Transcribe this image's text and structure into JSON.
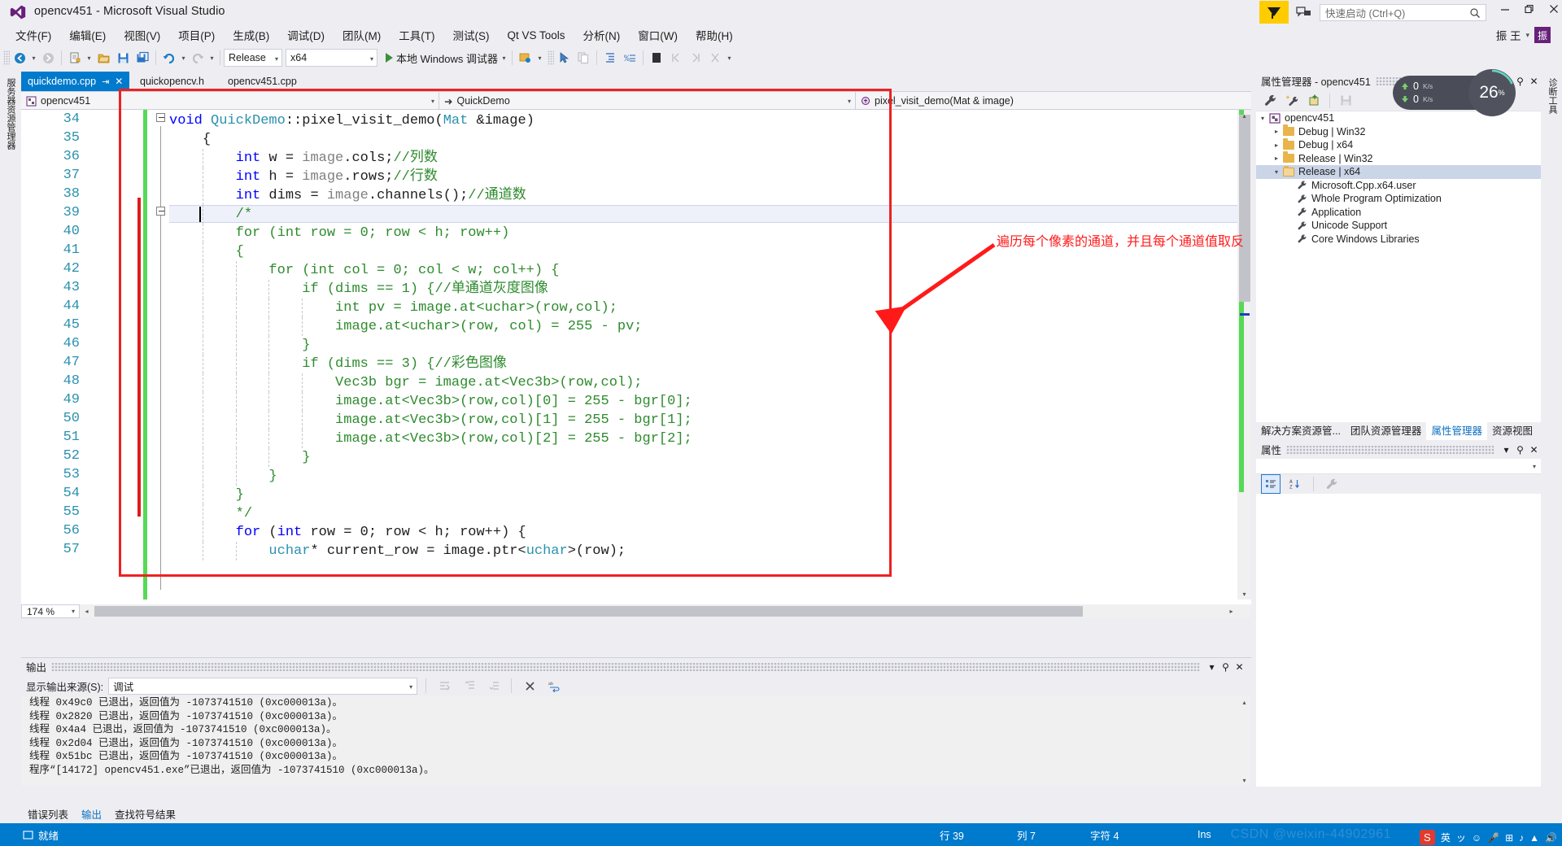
{
  "window": {
    "title": "opencv451 - Microsoft Visual Studio",
    "minimize": "—",
    "restore": "❐",
    "close": "✕",
    "user_name": "振 王",
    "user_caret": "▾",
    "avatar_initial": "振"
  },
  "quick_launch": {
    "placeholder": "快速启动 (Ctrl+Q)",
    "value": ""
  },
  "menu": {
    "items": [
      "文件(F)",
      "编辑(E)",
      "视图(V)",
      "项目(P)",
      "生成(B)",
      "调试(D)",
      "团队(M)",
      "工具(T)",
      "测试(S)",
      "Qt VS Tools",
      "分析(N)",
      "窗口(W)",
      "帮助(H)"
    ]
  },
  "toolbar": {
    "config": "Release",
    "platform": "x64",
    "run_label": "本地 Windows 调试器",
    "caret": "▾"
  },
  "editor_tabs": [
    {
      "label": "quickdemo.cpp",
      "active": true,
      "pin": "⇥",
      "close": "✕"
    },
    {
      "label": "quickopencv.h",
      "active": false
    },
    {
      "label": "opencv451.cpp",
      "active": false
    }
  ],
  "left_strip_label": "服务器资源管理器",
  "right_strip_label": "诊断工具",
  "navbar": {
    "project": "opencv451",
    "class": "QuickDemo",
    "member": "pixel_visit_demo(Mat & image)",
    "caret": "▾",
    "class_arrow": "➜",
    "member_icon": "⬤"
  },
  "code": {
    "first_line_number": 34,
    "lines": [
      {
        "n": 34,
        "indent": 0,
        "tokens": [
          {
            "t": "void ",
            "c": "kw"
          },
          {
            "t": "QuickDemo",
            "c": "typ"
          },
          {
            "t": "::pixel_visit_demo(",
            "c": ""
          },
          {
            "t": "Mat",
            "c": "typ"
          },
          {
            "t": " &image)",
            "c": ""
          }
        ]
      },
      {
        "n": 35,
        "indent": 1,
        "tokens": [
          {
            "t": "{",
            "c": ""
          }
        ]
      },
      {
        "n": 36,
        "indent": 2,
        "tokens": [
          {
            "t": "int",
            "c": "kw"
          },
          {
            "t": " w = ",
            "c": ""
          },
          {
            "t": "image",
            "c": "id-g"
          },
          {
            "t": ".cols;",
            "c": ""
          },
          {
            "t": "//列数",
            "c": "cmt"
          }
        ]
      },
      {
        "n": 37,
        "indent": 2,
        "tokens": [
          {
            "t": "int",
            "c": "kw"
          },
          {
            "t": " h = ",
            "c": ""
          },
          {
            "t": "image",
            "c": "id-g"
          },
          {
            "t": ".rows;",
            "c": ""
          },
          {
            "t": "//行数",
            "c": "cmt"
          }
        ]
      },
      {
        "n": 38,
        "indent": 2,
        "tokens": [
          {
            "t": "int",
            "c": "kw"
          },
          {
            "t": " dims = ",
            "c": ""
          },
          {
            "t": "image",
            "c": "id-g"
          },
          {
            "t": ".channels();",
            "c": ""
          },
          {
            "t": "//通道数",
            "c": "cmt"
          }
        ]
      },
      {
        "n": 39,
        "indent": 2,
        "tokens": [
          {
            "t": "/*",
            "c": "cmt"
          }
        ]
      },
      {
        "n": 40,
        "indent": 2,
        "tokens": [
          {
            "t": "for (int row = 0; row < h; row++)",
            "c": "cmt"
          }
        ]
      },
      {
        "n": 41,
        "indent": 2,
        "tokens": [
          {
            "t": "{",
            "c": "cmt"
          }
        ]
      },
      {
        "n": 42,
        "indent": 3,
        "tokens": [
          {
            "t": "for (int col = 0; col < w; col++) {",
            "c": "cmt"
          }
        ]
      },
      {
        "n": 43,
        "indent": 4,
        "tokens": [
          {
            "t": "if (dims == 1) {//单通道灰度图像",
            "c": "cmt"
          }
        ]
      },
      {
        "n": 44,
        "indent": 5,
        "tokens": [
          {
            "t": "int pv = image.at<uchar>(row,col);",
            "c": "cmt"
          }
        ]
      },
      {
        "n": 45,
        "indent": 5,
        "tokens": [
          {
            "t": "image.at<uchar>(row, col) = 255 - pv;",
            "c": "cmt"
          }
        ]
      },
      {
        "n": 46,
        "indent": 4,
        "tokens": [
          {
            "t": "}",
            "c": "cmt"
          }
        ]
      },
      {
        "n": 47,
        "indent": 4,
        "tokens": [
          {
            "t": "if (dims == 3) {//彩色图像",
            "c": "cmt"
          }
        ]
      },
      {
        "n": 48,
        "indent": 5,
        "tokens": [
          {
            "t": "Vec3b bgr = image.at<Vec3b>(row,col);",
            "c": "cmt"
          }
        ]
      },
      {
        "n": 49,
        "indent": 5,
        "tokens": [
          {
            "t": "image.at<Vec3b>(row,col)[0] = 255 - bgr[0];",
            "c": "cmt"
          }
        ]
      },
      {
        "n": 50,
        "indent": 5,
        "tokens": [
          {
            "t": "image.at<Vec3b>(row,col)[1] = 255 - bgr[1];",
            "c": "cmt"
          }
        ]
      },
      {
        "n": 51,
        "indent": 5,
        "tokens": [
          {
            "t": "image.at<Vec3b>(row,col)[2] = 255 - bgr[2];",
            "c": "cmt"
          }
        ]
      },
      {
        "n": 52,
        "indent": 4,
        "tokens": [
          {
            "t": "}",
            "c": "cmt"
          }
        ]
      },
      {
        "n": 53,
        "indent": 3,
        "tokens": [
          {
            "t": "}",
            "c": "cmt"
          }
        ]
      },
      {
        "n": 54,
        "indent": 2,
        "tokens": [
          {
            "t": "}",
            "c": "cmt"
          }
        ]
      },
      {
        "n": 55,
        "indent": 2,
        "tokens": [
          {
            "t": "*/",
            "c": "cmt"
          }
        ]
      },
      {
        "n": 56,
        "indent": 2,
        "tokens": [
          {
            "t": "for",
            "c": "kw"
          },
          {
            "t": " (",
            "c": ""
          },
          {
            "t": "int",
            "c": "kw"
          },
          {
            "t": " row = 0; row < h; row++) {",
            "c": ""
          }
        ]
      },
      {
        "n": 57,
        "indent": 3,
        "tokens": [
          {
            "t": "uchar",
            "c": "typ"
          },
          {
            "t": "* current_row = image.ptr<",
            "c": ""
          },
          {
            "t": "uchar",
            "c": "typ"
          },
          {
            "t": ">(row);",
            "c": ""
          }
        ]
      }
    ],
    "annotation": "遍历每个像素的通道，并且每个通道值取反",
    "zoom": "174 %"
  },
  "property_manager": {
    "title": "属性管理器 - opencv451",
    "auto_hide": "⚲",
    "close": "✕",
    "tree": [
      {
        "label": "opencv451",
        "depth": 0,
        "tri": "▲",
        "icon": "solution",
        "selected": false
      },
      {
        "label": "Debug | Win32",
        "depth": 1,
        "tri": "▷",
        "icon": "folder",
        "selected": false
      },
      {
        "label": "Debug | x64",
        "depth": 1,
        "tri": "▷",
        "icon": "folder",
        "selected": false
      },
      {
        "label": "Release | Win32",
        "depth": 1,
        "tri": "▷",
        "icon": "folder",
        "selected": false
      },
      {
        "label": "Release | x64",
        "depth": 1,
        "tri": "▲",
        "icon": "folder-open",
        "selected": true
      },
      {
        "label": "Microsoft.Cpp.x64.user",
        "depth": 2,
        "tri": "",
        "icon": "wrench",
        "selected": false
      },
      {
        "label": "Whole Program Optimization",
        "depth": 2,
        "tri": "",
        "icon": "wrench",
        "selected": false
      },
      {
        "label": "Application",
        "depth": 2,
        "tri": "",
        "icon": "wrench",
        "selected": false
      },
      {
        "label": "Unicode Support",
        "depth": 2,
        "tri": "",
        "icon": "wrench",
        "selected": false
      },
      {
        "label": "Core Windows Libraries",
        "depth": 2,
        "tri": "",
        "icon": "wrench",
        "selected": false
      }
    ]
  },
  "dock_tabs": [
    {
      "label": "解决方案资源管...",
      "active": false
    },
    {
      "label": "团队资源管理器",
      "active": false
    },
    {
      "label": "属性管理器",
      "active": true
    },
    {
      "label": "资源视图",
      "active": false
    }
  ],
  "properties_panel": {
    "title": "属性",
    "dropdown_caret": "▾",
    "pin": "⚲",
    "close": "✕",
    "selected_object": ""
  },
  "perf_badge": {
    "upload": "0",
    "upload_unit": "K/s",
    "download": "0",
    "download_unit": "K/s",
    "cpu": "26",
    "cpu_unit": "%"
  },
  "output": {
    "title": "输出",
    "source_label": "显示输出来源(S):",
    "source_value": "调试",
    "caret": "▾",
    "lines": [
      "线程 0x49c0 已退出，返回值为 -1073741510 (0xc000013a)。",
      "线程 0x2820 已退出，返回值为 -1073741510 (0xc000013a)。",
      "线程 0x4a4 已退出，返回值为 -1073741510 (0xc000013a)。",
      "线程 0x2d04 已退出，返回值为 -1073741510 (0xc000013a)。",
      "线程 0x51bc 已退出，返回值为 -1073741510 (0xc000013a)。",
      "程序“[14172] opencv451.exe”已退出，返回值为 -1073741510 (0xc000013a)。"
    ],
    "dropdown": "▾",
    "pin": "⚲",
    "close": "✕"
  },
  "bottom_tabs": [
    {
      "label": "错误列表",
      "active": false
    },
    {
      "label": "输出",
      "active": true
    },
    {
      "label": "查找符号结果",
      "active": false
    }
  ],
  "statusbar": {
    "ready": "就绪",
    "line_label": "行 39",
    "col_label": "列 7",
    "char_label": "字符 4",
    "insert_mode": "Ins",
    "watermark": "CSDN @weixin-44902961"
  },
  "tray": {
    "s_badge": "S",
    "items": [
      "英",
      "ッ",
      "☺",
      "🎤",
      "⊞",
      "♪",
      "▲",
      "🔊"
    ]
  },
  "colors": {
    "accent": "#007acc",
    "chrome": "#eeeef2",
    "annotation_red": "#ff1a1a",
    "comment_green": "#2e8b2e",
    "keyword_blue": "#0000ff",
    "type_teal": "#2b91af",
    "change_green": "#57d957",
    "change_red": "#e01b1b",
    "yellow_badge": "#ffcc00"
  }
}
